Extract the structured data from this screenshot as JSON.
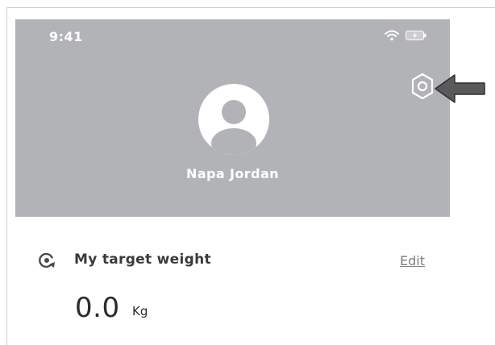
{
  "status_bar": {
    "time": "9:41",
    "wifi_icon": "wifi-icon",
    "battery_icon": "battery-charging-icon"
  },
  "profile": {
    "name": "Napa Jordan",
    "avatar_icon": "user-avatar-icon",
    "settings_icon": "hexagon-settings-icon"
  },
  "target_weight": {
    "icon": "target-refresh-icon",
    "label": "My target weight",
    "edit_label": "Edit",
    "value": "0.0",
    "unit": "Kg"
  },
  "colors": {
    "header_bg": "#b2b3b6",
    "header_text": "#ffffff",
    "body_text": "#3a3a3a",
    "link_text": "#7d7d7d",
    "arrow": "#555555"
  }
}
